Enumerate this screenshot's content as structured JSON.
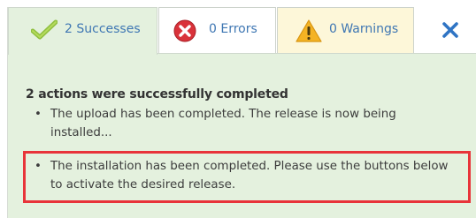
{
  "tabs": {
    "successes": {
      "label": "2 Successes",
      "icon": "check-icon"
    },
    "errors": {
      "label": "0 Errors",
      "icon": "error-x-icon"
    },
    "warnings": {
      "label": "0 Warnings",
      "icon": "warning-triangle-icon"
    }
  },
  "close": {
    "icon": "close-icon"
  },
  "message": {
    "heading": "2 actions were successfully completed",
    "items": [
      "The upload has been completed. The release is now being installed...",
      "The installation has been completed. Please use the buttons below to activate the desired release."
    ]
  },
  "colors": {
    "success_bg": "#e4f1de",
    "warning_bg": "#fdf7d9",
    "link_blue": "#3f77b3",
    "highlight_red": "#e8343a"
  }
}
